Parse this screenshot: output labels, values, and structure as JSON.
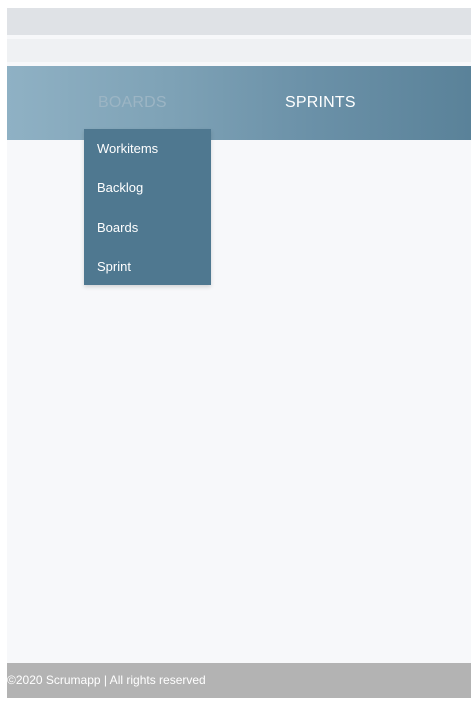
{
  "nav": {
    "tabs": [
      {
        "label": "BOARDS"
      },
      {
        "label": "SPRINTS"
      }
    ]
  },
  "dropdown": {
    "items": [
      {
        "label": "Workitems"
      },
      {
        "label": "Backlog"
      },
      {
        "label": "Boards"
      },
      {
        "label": "Sprint"
      }
    ]
  },
  "footer": {
    "text": "©2020 Scrumapp | All rights reserved"
  },
  "colors": {
    "navbar_start": "#8fb1c4",
    "navbar_end": "#5a8299",
    "dropdown_bg": "#4f7890",
    "footer_bg": "#b3b3b3"
  }
}
